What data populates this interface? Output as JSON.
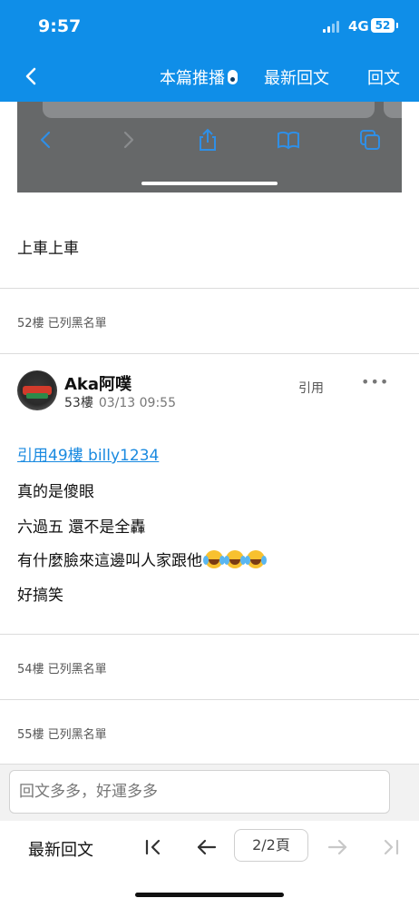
{
  "status": {
    "time": "9:57",
    "network": "4G",
    "battery": "52"
  },
  "nav": {
    "push_label": "本篇推播",
    "latest_reply_label": "最新回文",
    "reply_label": "回文"
  },
  "post_52": {
    "text": "上車上車",
    "blocked_note": "52樓 已列黑名單"
  },
  "post_53": {
    "username": "Aka阿噗",
    "floor": "53樓",
    "time": "03/13 09:55",
    "quote_button": "引用",
    "more_button": "•••",
    "quote_link": "引用49樓 billy1234",
    "lines": [
      "真的是傻眼",
      "六過五 還不是全轟",
      "有什麼臉來這邊叫人家跟他",
      "好搞笑"
    ],
    "emoji": "crying-laughing-emoji"
  },
  "blocked": {
    "floor_54": "54樓 已列黑名單",
    "floor_55": "55樓 已列黑名單"
  },
  "reply": {
    "placeholder": "回文多多，好運多多"
  },
  "footer": {
    "latest_label": "最新回文",
    "page_indicator": "2/2頁"
  },
  "colors": {
    "header_blue": "#0f8ee8",
    "link_blue": "#1a8ae0"
  }
}
